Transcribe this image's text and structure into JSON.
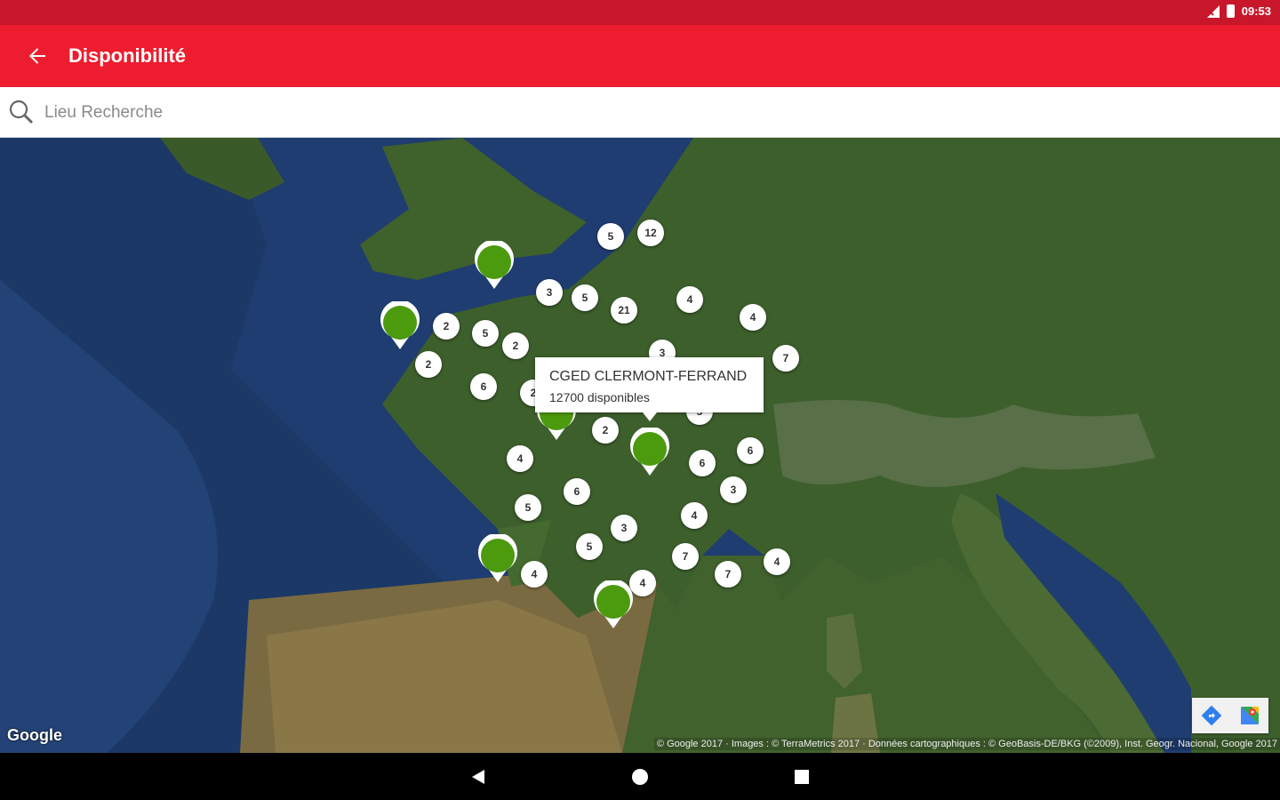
{
  "status_bar": {
    "time": "09:53"
  },
  "app_bar": {
    "title": "Disponibilité",
    "back_icon": "arrow-back-icon"
  },
  "search": {
    "placeholder": "Lieu Recherche",
    "value": "",
    "icon": "search-icon"
  },
  "map": {
    "clusters": [
      "5",
      "12",
      "3",
      "5",
      "21",
      "4",
      "4",
      "2",
      "5",
      "2",
      "2",
      "6",
      "2",
      "3",
      "7",
      "2",
      "4",
      "6",
      "6",
      "5",
      "6",
      "3",
      "3",
      "4",
      "5",
      "5",
      "4",
      "7",
      "7",
      "4",
      "4"
    ],
    "pins": [
      "site",
      "site",
      "site",
      "site",
      "site",
      "site"
    ],
    "info_window": {
      "title": "CGED CLERMONT-FERRAND",
      "subtitle": "12700 disponibles"
    },
    "logo": "Google",
    "attribution": "© Google 2017 · Images : © TerraMetrics 2017 · Données cartographiques : © GeoBasis-DE/BKG (©2009), Inst. Geogr. Nacional, Google 2017",
    "toolbar": [
      "directions-icon",
      "google-maps-icon"
    ]
  },
  "colors": {
    "status_bar": "#c8172a",
    "app_bar": "#ed1c2e",
    "pin": "#4c9a0e",
    "sea": "#1f3d70",
    "land": "#3b5e2c"
  },
  "nav_bar": [
    "back-triangle-icon",
    "home-circle-icon",
    "recents-square-icon"
  ]
}
